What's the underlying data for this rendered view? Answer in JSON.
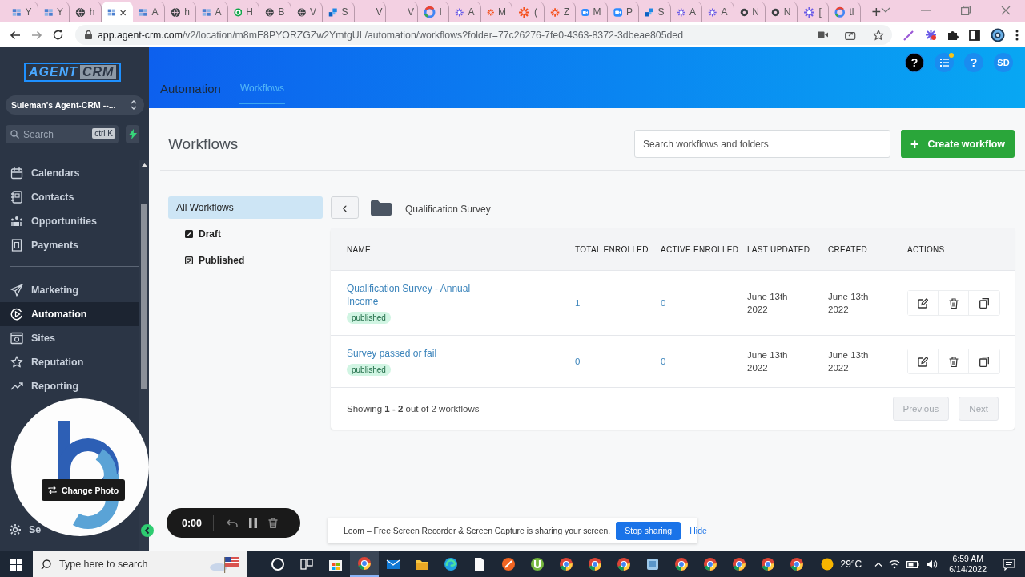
{
  "browser": {
    "tabs": [
      {
        "kind": "grid",
        "title": "Y",
        "selected": false
      },
      {
        "kind": "grid",
        "title": "Y",
        "selected": false
      },
      {
        "kind": "globe",
        "title": "h",
        "selected": false
      },
      {
        "kind": "grid",
        "selected": true,
        "close": "×"
      },
      {
        "kind": "grid",
        "title": "A",
        "selected": false
      },
      {
        "kind": "globe",
        "title": "h",
        "selected": false
      },
      {
        "kind": "grid",
        "title": "A",
        "selected": false
      },
      {
        "kind": "green",
        "title": "H",
        "selected": false
      },
      {
        "kind": "globe",
        "title": "B",
        "selected": false
      },
      {
        "kind": "globe",
        "title": "V",
        "selected": false
      },
      {
        "kind": "blocks",
        "title": "S",
        "selected": false
      },
      {
        "kind": "blank",
        "title": "V",
        "selected": false
      },
      {
        "kind": "blank",
        "title": "V",
        "selected": false
      },
      {
        "kind": "google",
        "title": "I",
        "selected": false
      },
      {
        "kind": "flower",
        "title": "A",
        "selected": false
      },
      {
        "kind": "sun",
        "title": "M",
        "selected": false
      },
      {
        "kind": "sun",
        "title": "(",
        "selected": false
      },
      {
        "kind": "sun",
        "title": "Z",
        "selected": false
      },
      {
        "kind": "camera",
        "title": "M",
        "selected": false
      },
      {
        "kind": "camera",
        "title": "P",
        "selected": false
      },
      {
        "kind": "blocks",
        "title": "S",
        "selected": false
      },
      {
        "kind": "flower",
        "title": "A",
        "selected": false
      },
      {
        "kind": "flower",
        "title": "A",
        "selected": false
      },
      {
        "kind": "ring",
        "title": "N",
        "selected": false
      },
      {
        "kind": "ring",
        "title": "N",
        "selected": false
      },
      {
        "kind": "flower",
        "title": "[",
        "selected": false
      },
      {
        "kind": "google",
        "title": "tl",
        "selected": false
      }
    ],
    "new_tab": "+",
    "url": {
      "domain": "app.agent-crm.com",
      "path": "/v2/location/m8mE8PYORZGZw2YmtgUL/automation/workflows?folder=77c26276-7fe0-4363-8372-3dbeae805ded"
    }
  },
  "sidebar": {
    "logo": {
      "first": "AGENT",
      "second": "CRM"
    },
    "account": "Suleman's Agent-CRM --...",
    "search": {
      "placeholder": "Search",
      "shortcut": "ctrl K"
    },
    "sections": [
      {
        "items": [
          {
            "kind": "calendar",
            "label": "Calendars",
            "selected": false
          },
          {
            "kind": "contacts",
            "label": "Contacts",
            "selected": false
          },
          {
            "kind": "opportunities",
            "label": "Opportunities",
            "selected": false
          },
          {
            "kind": "payments",
            "label": "Payments",
            "selected": false
          }
        ]
      },
      {
        "items": [
          {
            "kind": "marketing",
            "label": "Marketing",
            "selected": false
          },
          {
            "kind": "automation",
            "label": "Automation",
            "selected": true
          },
          {
            "kind": "sites",
            "label": "Sites",
            "selected": false
          },
          {
            "kind": "reputation",
            "label": "Reputation",
            "selected": false
          },
          {
            "kind": "reporting",
            "label": "Reporting",
            "selected": false
          }
        ]
      }
    ],
    "footer_item": {
      "kind": "settings",
      "label": "Se",
      "selected": false
    }
  },
  "header": {
    "title": "Automation",
    "tabs": [
      {
        "label": "Workflows",
        "selected": true
      }
    ],
    "actions": [
      {
        "kind": "help_dark",
        "label": "?"
      },
      {
        "kind": "tasks",
        "notification": true
      },
      {
        "kind": "help",
        "label": "?"
      },
      {
        "kind": "avatar",
        "label": "SD"
      }
    ]
  },
  "page": {
    "title": "Workflows",
    "search": {
      "placeholder": "Search workflows and folders"
    },
    "create_button": {
      "icon": "+",
      "label": "Create workflow"
    },
    "filters": [
      {
        "kind": "all",
        "label": "All Workflows",
        "selected": true
      },
      {
        "kind": "draft",
        "label": "Draft",
        "selected": false
      },
      {
        "kind": "published",
        "label": "Published",
        "selected": false
      }
    ],
    "back_button": "‹",
    "folder": "Qualification Survey",
    "table": {
      "columns": [
        "NAME",
        "TOTAL ENROLLED",
        "ACTIVE ENROLLED",
        "LAST UPDATED",
        "CREATED",
        "ACTIONS"
      ],
      "rows": [
        {
          "name": "Qualification Survey - Annual Income",
          "status": "published",
          "total_enrolled": "1",
          "active_enrolled": "0",
          "last_updated": "June 13th 2022",
          "created": "June 13th 2022"
        },
        {
          "name": "Survey passed or fail",
          "status": "published",
          "total_enrolled": "0",
          "active_enrolled": "0",
          "last_updated": "June 13th 2022",
          "created": "June 13th 2022"
        }
      ]
    },
    "summary": "Showing **1 - 2** out of 2 workflows",
    "pagination": [
      {
        "label": "Previous",
        "disabled": true
      },
      {
        "label": "Next",
        "disabled": true
      }
    ]
  },
  "recorder": {
    "time": "0:00"
  },
  "camera": {
    "button": "Change Photo"
  },
  "share_banner": {
    "message": "Loom – Free Screen Recorder & Screen Capture is sharing your screen.",
    "stop_button": "Stop sharing",
    "hide_link": "Hide"
  },
  "taskbar": {
    "search": {
      "placeholder": "Type here to search"
    },
    "weather": "29°C",
    "time": "6:59 AM",
    "date": "6/14/2022"
  }
}
